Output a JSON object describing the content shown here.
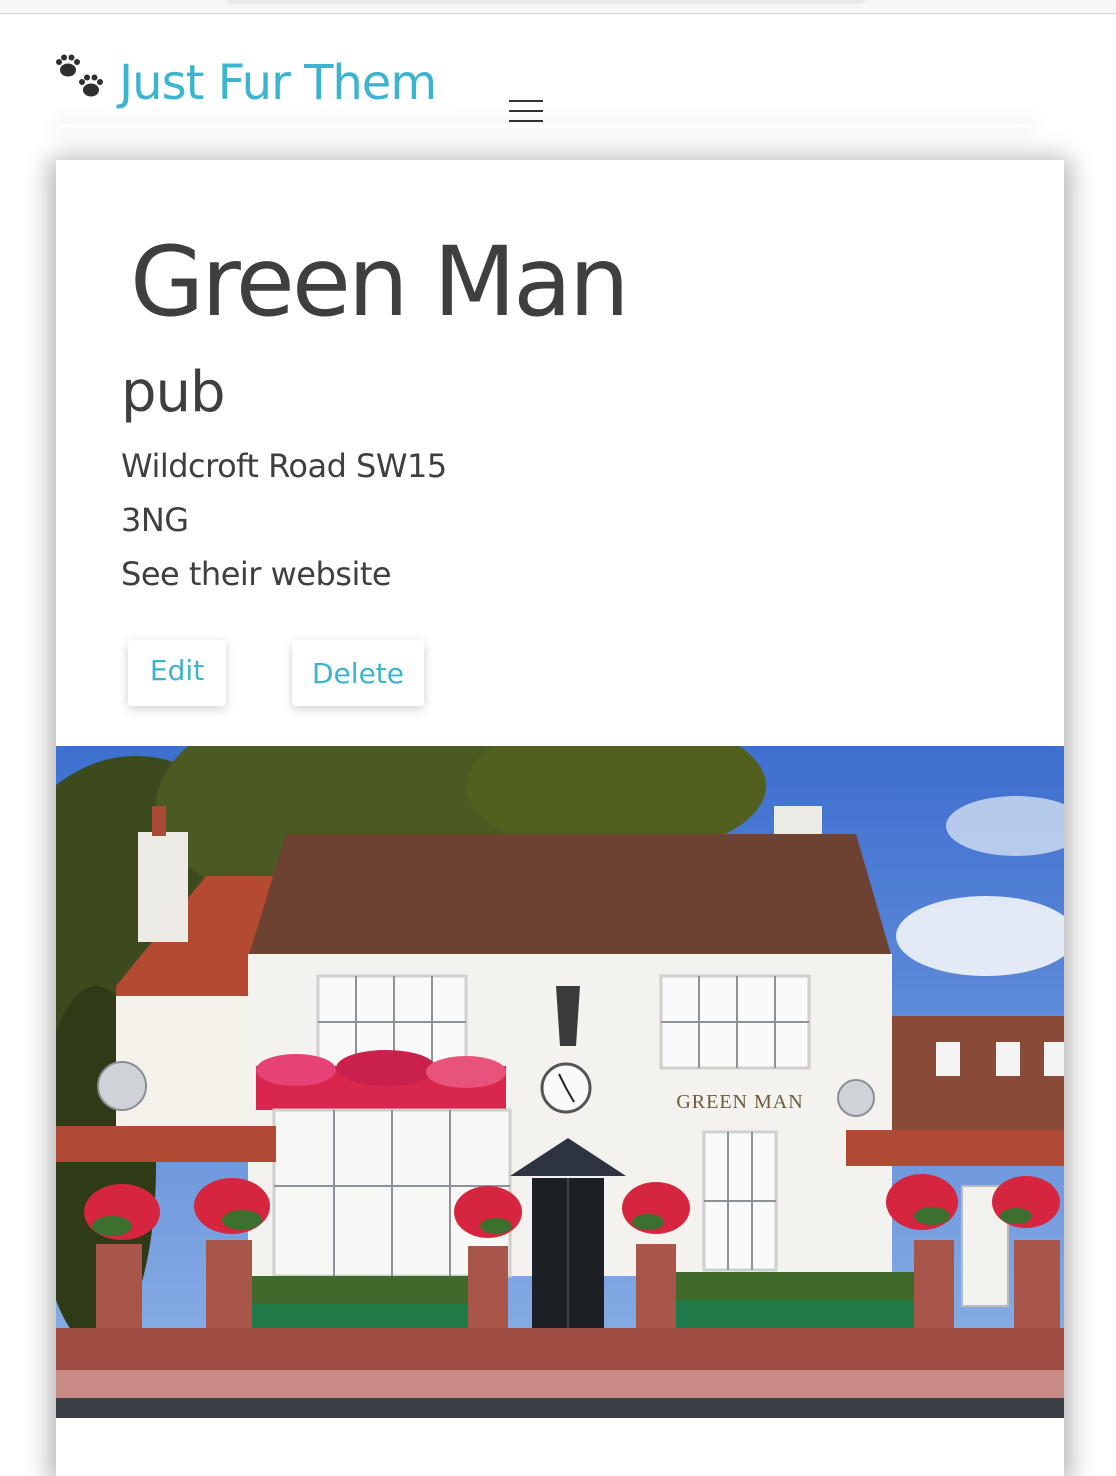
{
  "nav": {
    "brand": "Just Fur Them",
    "logo_icon": "paw-prints-icon",
    "menu_icon": "hamburger-menu-icon"
  },
  "venue": {
    "name": "Green Man",
    "category": "pub",
    "address_line_1": "Wildcroft Road SW15",
    "address_line_2": "3NG",
    "website_link": "See their website"
  },
  "actions": {
    "edit_label": "Edit",
    "delete_label": "Delete"
  },
  "photo": {
    "sign_text": "GREEN MAN"
  },
  "colors": {
    "accent": "#3cb4d0",
    "text": "#3f3f3f"
  }
}
